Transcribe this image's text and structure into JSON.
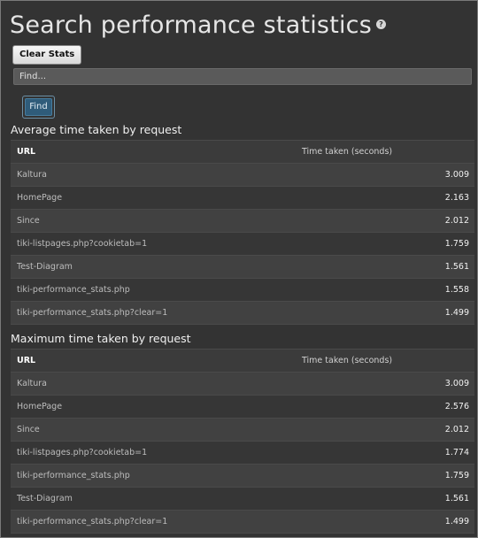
{
  "page": {
    "title": "Search performance statistics",
    "help_glyph": "?"
  },
  "controls": {
    "clear_label": "Clear Stats",
    "find_placeholder": "Find...",
    "find_label": "Find"
  },
  "columns": {
    "url": "URL",
    "time": "Time taken (seconds)"
  },
  "average": {
    "title": "Average time taken by request",
    "rows": [
      {
        "url": "Kaltura",
        "time": "3.009"
      },
      {
        "url": "HomePage",
        "time": "2.163"
      },
      {
        "url": "Since",
        "time": "2.012"
      },
      {
        "url": "tiki-listpages.php?cookietab=1",
        "time": "1.759"
      },
      {
        "url": "Test-Diagram",
        "time": "1.561"
      },
      {
        "url": "tiki-performance_stats.php",
        "time": "1.558"
      },
      {
        "url": "tiki-performance_stats.php?clear=1",
        "time": "1.499"
      }
    ]
  },
  "maximum": {
    "title": "Maximum time taken by request",
    "rows": [
      {
        "url": "Kaltura",
        "time": "3.009"
      },
      {
        "url": "HomePage",
        "time": "2.576"
      },
      {
        "url": "Since",
        "time": "2.012"
      },
      {
        "url": "tiki-listpages.php?cookietab=1",
        "time": "1.774"
      },
      {
        "url": "tiki-performance_stats.php",
        "time": "1.759"
      },
      {
        "url": "Test-Diagram",
        "time": "1.561"
      },
      {
        "url": "tiki-performance_stats.php?clear=1",
        "time": "1.499"
      }
    ]
  }
}
